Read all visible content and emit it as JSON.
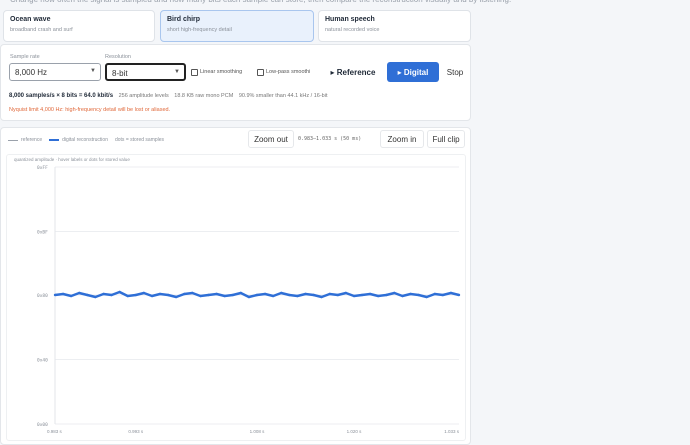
{
  "presets": [
    {
      "title": "Ocean wave",
      "subtitle": "broadband crash and surf",
      "active": false
    },
    {
      "title": "Bird chirp",
      "subtitle": "short high-frequency detail",
      "active": true
    },
    {
      "title": "Human speech",
      "subtitle": "natural recorded voice",
      "active": false
    }
  ],
  "controls": {
    "sample_rate_label": "Sample rate",
    "sample_rate_value": "8,000 Hz",
    "resolution_label": "Resolution",
    "resolution_value": "8-bit",
    "linear_smoothing_label": "Linear smoothing",
    "lowpass_label": "Low-pass smoothi",
    "reference_button": "▸ Reference",
    "digital_button": "▸ Digital",
    "stop_button": "Stop"
  },
  "info": {
    "bitrate": "8,000 samples/s × 8 bits = 64.0 kbit/s",
    "levels": "256 amplitude levels",
    "size": "18.8 KB raw mono PCM",
    "ratio": "90.9% smaller than 44.1 kHz / 16-bit",
    "warning": "Nyquist limit 4,000 Hz: high-frequency detail will be lost or aliased."
  },
  "chart_header": {
    "legend_reference": "reference",
    "legend_digital": "digital reconstruction",
    "legend_dots": "dots = stored samples",
    "zoom_out": "Zoom out",
    "range": "0.983–1.033 s (50 ms)",
    "zoom_in": "Zoom in",
    "full_clip": "Full clip",
    "y_hint": "quantized amplitude · hover labels or dots for stored value"
  },
  "chart_data": {
    "type": "line",
    "ylabel": "quantized amplitude",
    "ylim": [
      0,
      255
    ],
    "y_ticks": [
      "0x00",
      "0x40",
      "0x80",
      "0xBF",
      "0xFF"
    ],
    "y_tick_values": [
      0,
      64,
      128,
      191,
      255
    ],
    "xlim": [
      0.983,
      1.033
    ],
    "x_ticks": [
      "0.983 s",
      "0.993 s",
      "1.008 s",
      "1.020 s",
      "1.033 s"
    ],
    "x_tick_values": [
      0.983,
      0.993,
      1.008,
      1.02,
      1.033
    ],
    "series": [
      {
        "name": "digital reconstruction",
        "color": "#2f6fd6",
        "x": [
          0.983,
          0.984,
          0.985,
          0.986,
          0.987,
          0.988,
          0.989,
          0.99,
          0.991,
          0.992,
          0.993,
          0.994,
          0.995,
          0.996,
          0.997,
          0.998,
          0.999,
          1.0,
          1.001,
          1.002,
          1.003,
          1.004,
          1.005,
          1.006,
          1.007,
          1.008,
          1.009,
          1.01,
          1.011,
          1.012,
          1.013,
          1.014,
          1.015,
          1.016,
          1.017,
          1.018,
          1.019,
          1.02,
          1.021,
          1.022,
          1.023,
          1.024,
          1.025,
          1.026,
          1.027,
          1.028,
          1.029,
          1.03,
          1.031,
          1.032,
          1.033
        ],
        "values": [
          128,
          129,
          127,
          130,
          128,
          126,
          129,
          128,
          131,
          127,
          128,
          130,
          127,
          129,
          128,
          126,
          129,
          130,
          127,
          128,
          129,
          127,
          128,
          130,
          126,
          128,
          129,
          127,
          130,
          128,
          127,
          129,
          128,
          126,
          129,
          128,
          130,
          127,
          128,
          129,
          127,
          128,
          130,
          127,
          129,
          128,
          126,
          129,
          128,
          130,
          128
        ]
      }
    ]
  }
}
